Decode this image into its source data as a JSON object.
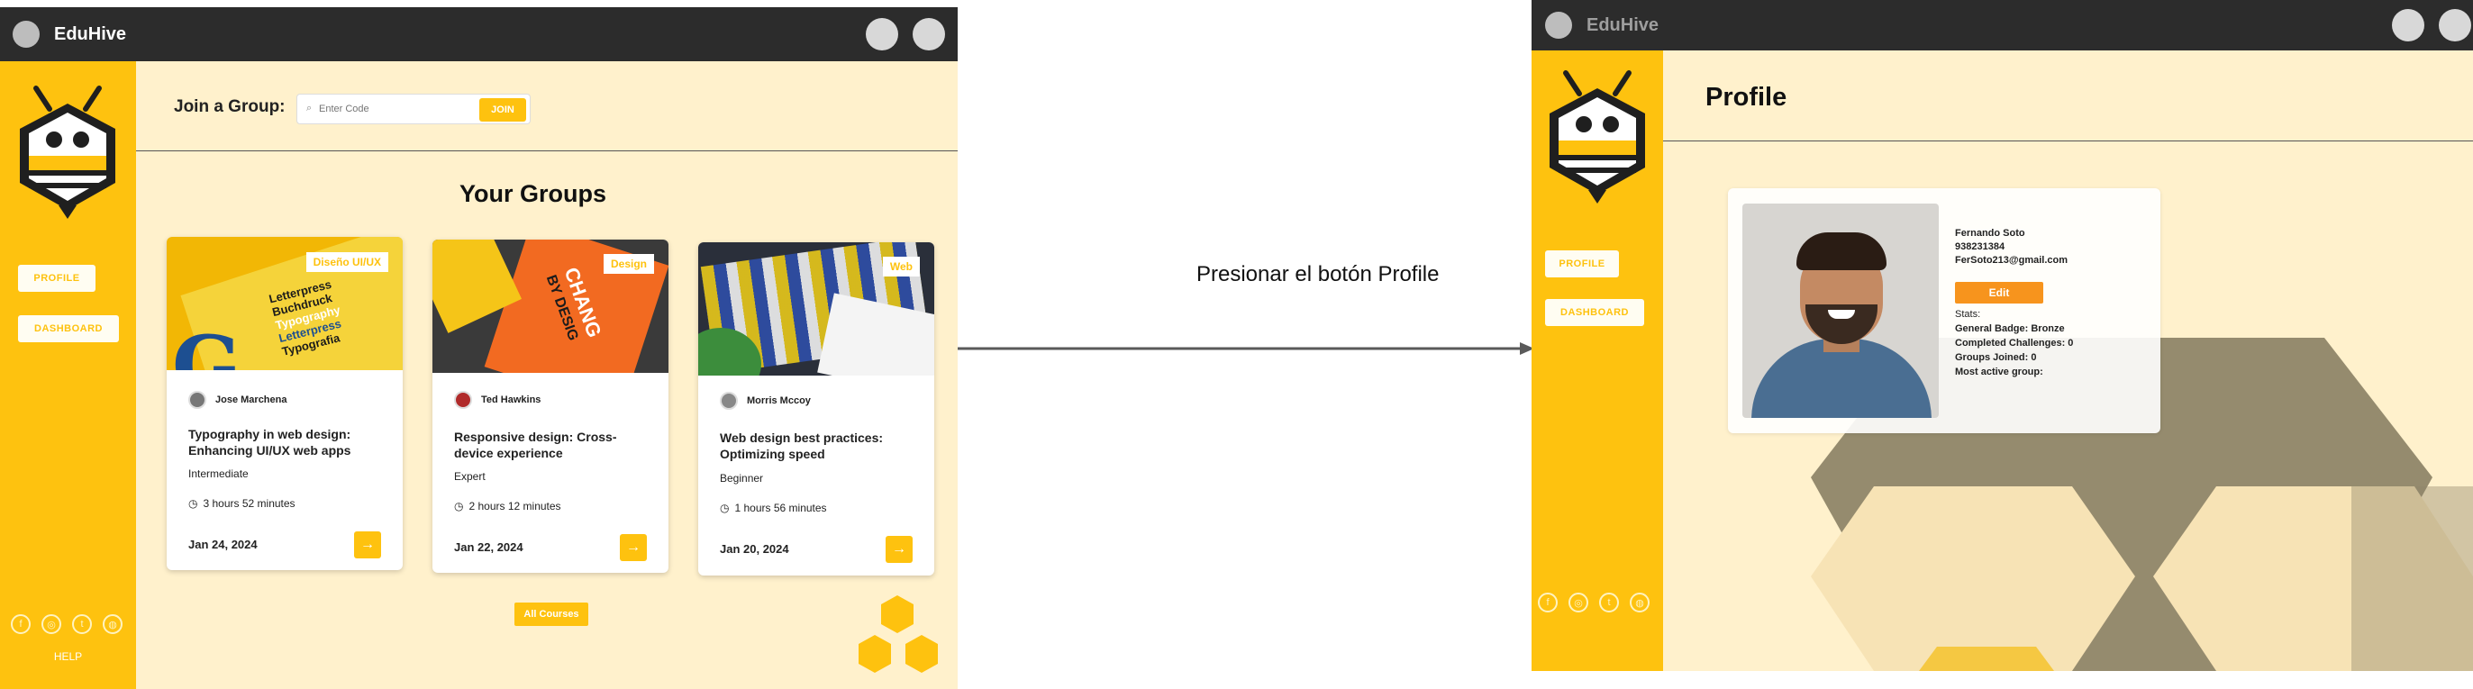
{
  "left_screen": {
    "app_title": "EduHive",
    "sidebar": {
      "profile_label": "PROFILE",
      "dashboard_label": "DASHBOARD",
      "help_label": "HELP",
      "social_icons": [
        "facebook-icon",
        "instagram-icon",
        "twitter-icon",
        "globe-icon"
      ]
    },
    "join": {
      "label": "Join a Group:",
      "placeholder": "Enter Code",
      "button": "JOIN"
    },
    "groups_title": "Your Groups",
    "cards": [
      {
        "tag": "Diseño UI/UX",
        "author": "Jose Marchena",
        "title": "Typography in web design: Enhancing UI/UX web apps",
        "level": "Intermediate",
        "duration": "3 hours 52 minutes",
        "date": "Jan 24, 2024",
        "image_words": [
          "Letterpress",
          "Buchdruck",
          "Typography",
          "Letterpress",
          "Typografia"
        ]
      },
      {
        "tag": "Design",
        "author": "Ted Hawkins",
        "title": "Responsive design: Cross-device experience",
        "level": "Expert",
        "duration": "2 hours 12 minutes",
        "date": "Jan 22, 2024",
        "image_words": [
          "CHANG",
          "BY DESIG"
        ]
      },
      {
        "tag": "Web",
        "author": "Morris Mccoy",
        "title": "Web design best practices: Optimizing speed",
        "level": "Beginner",
        "duration": "1 hours 56 minutes",
        "date": "Jan 20, 2024"
      }
    ],
    "all_courses": "All Courses"
  },
  "annotation": {
    "text": "Presionar el botón Profile"
  },
  "right_screen": {
    "app_title": "EduHive",
    "sidebar": {
      "profile_label": "PROFILE",
      "dashboard_label": "DASHBOARD",
      "social_icons": [
        "facebook-icon",
        "instagram-icon",
        "twitter-icon",
        "globe-icon"
      ]
    },
    "page_title": "Profile",
    "profile": {
      "name": "Fernando Soto",
      "phone": "938231384",
      "email": "FerSoto213@gmail.com",
      "edit_button": "Edit",
      "stats_label": "Stats:",
      "badge": "General Badge: Bronze",
      "challenges": "Completed Challenges: 0",
      "groups": "Groups Joined: 0",
      "active_group": "Most active group:"
    }
  },
  "colors": {
    "brand_yellow": "#fec20f",
    "background_cream": "#fff1cc",
    "titlebar": "#2c2c2c",
    "edit_orange": "#f7941d",
    "hex_gray": "#8f8568"
  }
}
